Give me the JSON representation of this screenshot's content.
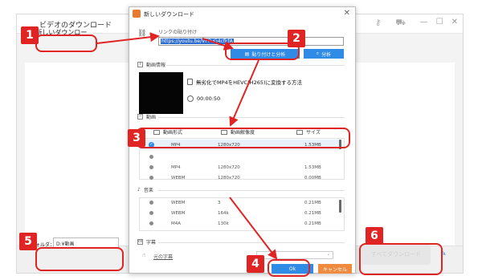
{
  "app": {
    "title": "ビデオのダウンロード",
    "new_download_label": "新しいダウンロー",
    "output_folder_label": "出力フォルダ：",
    "output_folder_value": "D:¥動画",
    "download_button": "すべてダウンロード"
  },
  "dialog": {
    "title": "新しいダウンロード",
    "link_label": "リンクの貼り付け",
    "url": "https://youtu.be/VPPuG4cfkfA",
    "paste_analyze": "貼り付けと分析",
    "analyze": "分析",
    "video_info_label": "動画情報",
    "video_title": "無劣化でMP4をHEVC(H265)に変換する方法",
    "video_duration": "00:00:50",
    "video_section": "動画",
    "col_format": "動画形式",
    "col_resolution": "動画解像度",
    "col_size": "サイズ",
    "video_rows": [
      {
        "format": "MP4",
        "resolution": "1280x720",
        "size": "1.53MB"
      },
      {
        "format": "",
        "resolution": "",
        "size": ""
      },
      {
        "format": "MP4",
        "resolution": "1280x720",
        "size": "1.53MB"
      },
      {
        "format": "WEBM",
        "resolution": "1280x720",
        "size": "0.00MB"
      }
    ],
    "audio_section": "音楽",
    "audio_rows": [
      {
        "format": "WEBM",
        "bitrate": "3",
        "size": "0.21MB"
      },
      {
        "format": "WEBM",
        "bitrate": "164k",
        "size": "0.21MB"
      },
      {
        "format": "M4A",
        "bitrate": "130k",
        "size": "0.21MB"
      }
    ],
    "subtitle_section": "字幕",
    "subtitle_value": "元の字幕",
    "ok": "Ok",
    "cancel": "キャンセル"
  },
  "annotations": {
    "markers": [
      "1",
      "2",
      "3",
      "4",
      "5",
      "6"
    ],
    "color": "#e02424"
  },
  "colors": {
    "accent": "#2f8be6",
    "cancel": "#ef8a3f"
  }
}
